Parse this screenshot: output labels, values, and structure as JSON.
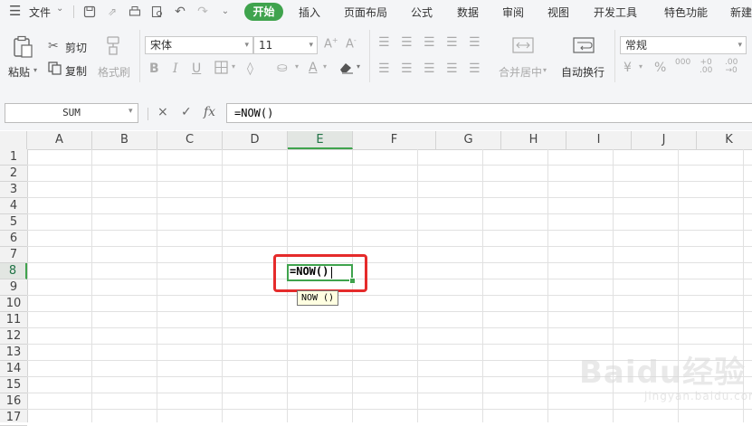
{
  "menu": {
    "hamburger_icon": "menu-icon",
    "file_label": "文件",
    "tabs": [
      "开始",
      "插入",
      "页面布局",
      "公式",
      "数据",
      "审阅",
      "视图",
      "开发工具",
      "特色功能",
      "新建"
    ],
    "active_tab": "开始",
    "accent_color": "#3fa34d"
  },
  "ribbon": {
    "paste_label": "粘贴",
    "cut_label": "剪切",
    "copy_label": "复制",
    "format_painter_label": "格式刷",
    "font_name": "宋体",
    "font_size": "11",
    "merge_center_label": "合并居中",
    "wrap_text_label": "自动换行",
    "number_format": "常规"
  },
  "formula_bar": {
    "name_box": "SUM",
    "cancel_icon": "×",
    "confirm_icon": "✓",
    "fx_label": "fx",
    "formula": "=NOW()"
  },
  "grid": {
    "columns": [
      "A",
      "B",
      "C",
      "D",
      "E",
      "F",
      "G",
      "H",
      "I",
      "J",
      "K"
    ],
    "rows": [
      "1",
      "2",
      "3",
      "4",
      "5",
      "6",
      "7",
      "8",
      "9",
      "10",
      "11",
      "12",
      "13",
      "14",
      "15",
      "16",
      "17"
    ],
    "selected_column": "E",
    "selected_row": "8",
    "active_cell_text": "=NOW()",
    "tooltip_text": "NOW ()",
    "highlight_color": "#e52b2b"
  },
  "watermark": {
    "logo_text": "Baidu经验",
    "url_text": "jingyan.baidu.com"
  }
}
